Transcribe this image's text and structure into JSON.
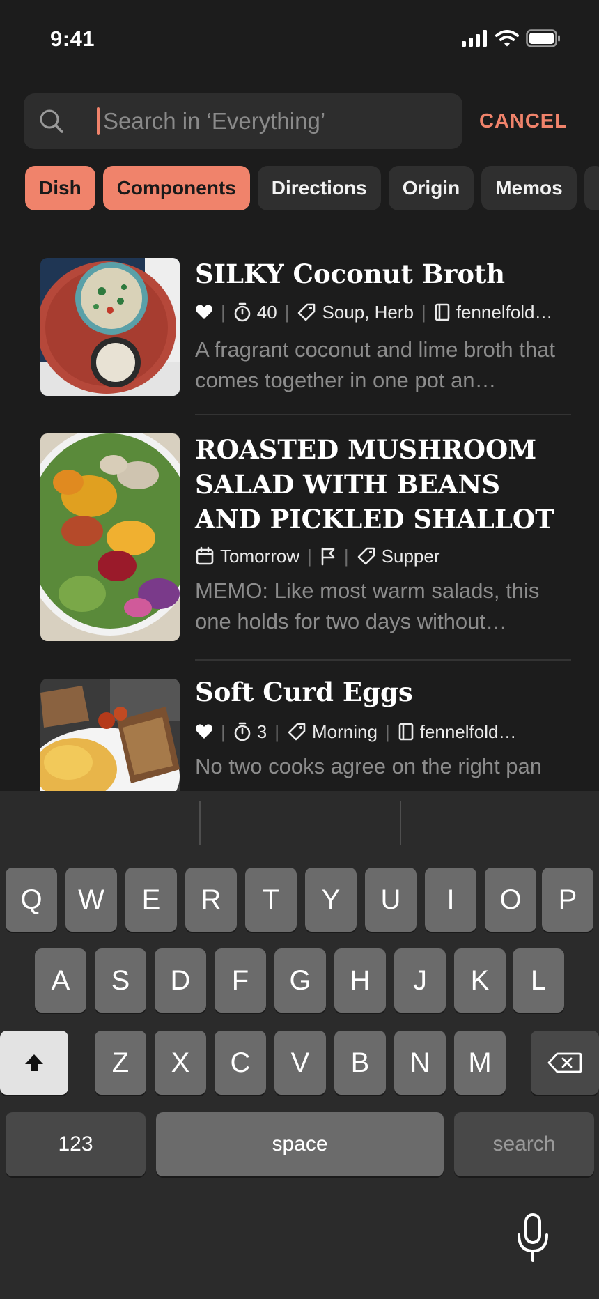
{
  "status": {
    "time": "9:41",
    "icons": [
      "cellular-icon",
      "wifi-icon",
      "battery-icon"
    ]
  },
  "search": {
    "placeholder": "Search in ‘Everything’",
    "value": "",
    "cancel_label": "CANCEL"
  },
  "chips": [
    {
      "label": "Dish",
      "active": true
    },
    {
      "label": "Components",
      "active": true
    },
    {
      "label": "Directions",
      "active": false
    },
    {
      "label": "Origin",
      "active": false
    },
    {
      "label": "Memos",
      "active": false
    }
  ],
  "results": [
    {
      "title": "SILKY Coconut Broth",
      "meta": {
        "favorite": true,
        "time": "40",
        "tags": "Soup, Herb",
        "source": "fennelfold…"
      },
      "description": "A fragrant coconut and lime broth that comes together in one pot an…"
    },
    {
      "title": "ROASTED MUSHROOM SALAD WITH BEANS AND PICKLED SHALLOT",
      "meta": {
        "date": "Tomorrow",
        "flag": true,
        "tags": "Supper"
      },
      "description": "MEMO: Like most warm salads, this one holds for two days without…"
    },
    {
      "title": "Soft Curd Eggs",
      "meta": {
        "favorite": true,
        "time": "3",
        "tags": "Morning",
        "source": "fennelfold…"
      },
      "description": "No two cooks agree on the right pan"
    }
  ],
  "keyboard": {
    "row1": [
      "Q",
      "W",
      "E",
      "R",
      "T",
      "Y",
      "U",
      "I",
      "O",
      "P"
    ],
    "row2": [
      "A",
      "S",
      "D",
      "F",
      "G",
      "H",
      "J",
      "K",
      "L"
    ],
    "row3": [
      "Z",
      "X",
      "C",
      "V",
      "B",
      "N",
      "M"
    ],
    "numbers_label": "123",
    "space_label": "space",
    "search_label": "search"
  },
  "colors": {
    "accent": "#f0836b",
    "background": "#1c1c1c",
    "keyboard": "#2b2b2b"
  }
}
